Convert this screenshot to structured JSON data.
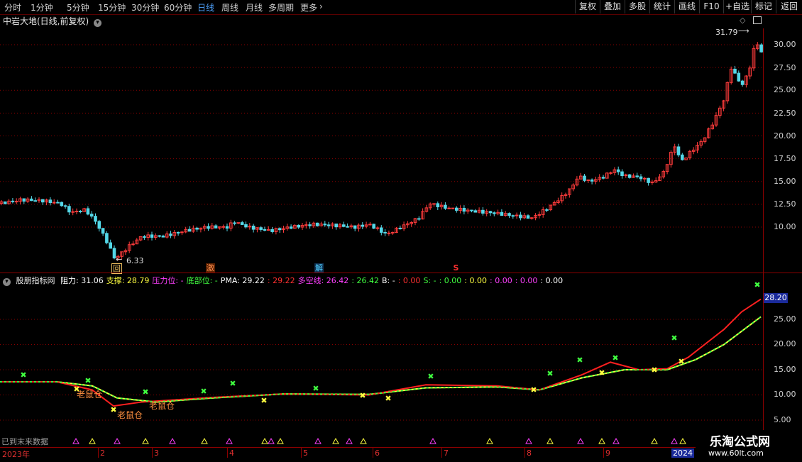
{
  "toolbar": {
    "periods": [
      "分时",
      "1分钟",
      "5分钟",
      "15分钟",
      "30分钟",
      "60分钟",
      "日线",
      "周线",
      "月线",
      "多周期",
      "更多"
    ],
    "active_period": "日线",
    "more_chevron": "chevron-right-icon",
    "right_buttons": [
      "复权",
      "叠加",
      "多股",
      "统计",
      "画线",
      "F10",
      "+自选",
      "标记",
      "返回"
    ]
  },
  "main": {
    "title": "中岩大地(日线,前复权)",
    "high_label": "31.79",
    "low_label": "6.33",
    "y_ticks": [
      "30.00",
      "27.50",
      "25.00",
      "22.50",
      "20.00",
      "17.50",
      "15.00",
      "12.50",
      "10.00"
    ],
    "signals": [
      {
        "text": "回",
        "color": "#f0c060"
      },
      {
        "text": "激",
        "color": "#ff8040"
      },
      {
        "text": "解",
        "color": "#40c0ff"
      },
      {
        "text": "S",
        "color": "#ff3030"
      }
    ]
  },
  "indicator": {
    "name": "股朋指标网",
    "fields": [
      {
        "text": "阻力: 31.06",
        "color": "#ffffff"
      },
      {
        "text": "支撑: 28.79",
        "color": "#ffff40"
      },
      {
        "text": "压力位: -",
        "color": "#ff40ff"
      },
      {
        "text": "底部位: -",
        "color": "#40ff40"
      },
      {
        "text": "PMA: 29.22",
        "color": "#ffffff"
      },
      {
        "text": ": 29.22",
        "color": "#ff3030"
      },
      {
        "text": "多空线: 26.42",
        "color": "#ff40ff"
      },
      {
        "text": ": 26.42",
        "color": "#40ff40"
      },
      {
        "text": "B: -",
        "color": "#ffffff"
      },
      {
        "text": ": 0.00",
        "color": "#ff3030"
      },
      {
        "text": "S: -",
        "color": "#40ff40"
      },
      {
        "text": ": 0.00",
        "color": "#40ff40"
      },
      {
        "text": ": 0.00",
        "color": "#ffff40"
      },
      {
        "text": ": 0.00",
        "color": "#ff40ff"
      },
      {
        "text": ": 0.00",
        "color": "#ff40ff"
      },
      {
        "text": ": 0.00",
        "color": "#ffffff"
      }
    ],
    "y_ticks": [
      "25.00",
      "20.00",
      "15.00",
      "10.00",
      "5.00"
    ],
    "last_value": "28.20",
    "labels": [
      "老鼠仓",
      "老鼠仓",
      "老鼠仓"
    ],
    "bottom_text": "已到末来数据"
  },
  "dates": [
    "2023年",
    "2",
    "3",
    "4",
    "5",
    "6",
    "7",
    "8",
    "9",
    "2024"
  ],
  "watermark": {
    "title": "乐淘公式网",
    "url": "www.60lt.com"
  }
}
